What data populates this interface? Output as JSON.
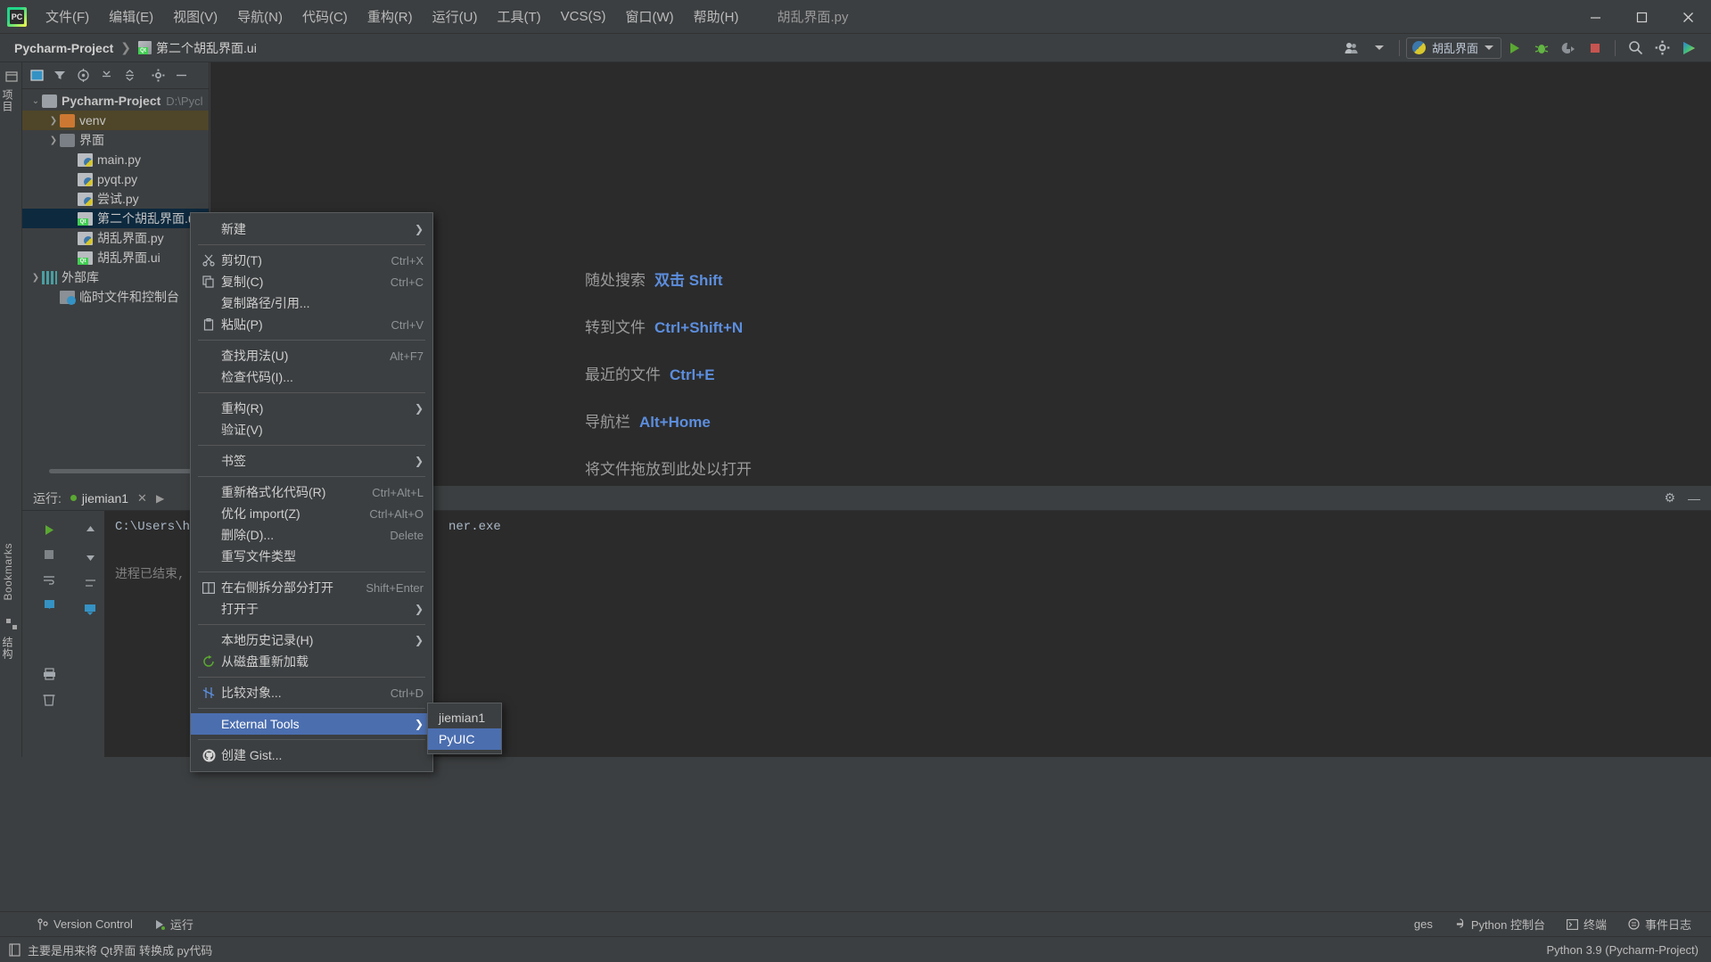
{
  "window": {
    "tab_title": "胡乱界面.py",
    "minimize": "—",
    "maximize": "▢",
    "close": "✕"
  },
  "menubar": [
    {
      "label": "文件(F)"
    },
    {
      "label": "编辑(E)"
    },
    {
      "label": "视图(V)"
    },
    {
      "label": "导航(N)"
    },
    {
      "label": "代码(C)"
    },
    {
      "label": "重构(R)"
    },
    {
      "label": "运行(U)"
    },
    {
      "label": "工具(T)"
    },
    {
      "label": "VCS(S)"
    },
    {
      "label": "窗口(W)"
    },
    {
      "label": "帮助(H)"
    }
  ],
  "navbar": {
    "crumb1": "Pycharm-Project",
    "separator": "❯",
    "crumb2": "第二个胡乱界面.ui",
    "run_config": "胡乱界面",
    "icons": {
      "profile": "profile-icon",
      "run": "▶",
      "debug": "debug-icon",
      "coverage": "coverage-icon",
      "stop": "■",
      "search": "⌕",
      "settings": "⚙",
      "updates": "updates-icon"
    }
  },
  "left_strip": {
    "project_label": "项目",
    "structure_label": "结构",
    "bookmarks_label": "Bookmarks"
  },
  "project_panel": {
    "toolbar_icons": [
      "window-icon",
      "filter-icon",
      "locate-icon",
      "expand-all-icon",
      "collapse-all-icon",
      "gear-icon",
      "hide-icon"
    ],
    "tree": [
      {
        "label": "Pycharm-Project",
        "path": "D:\\Pycl",
        "icon": "folder-icon",
        "arrow": "⌄",
        "indent": 0,
        "state": "root"
      },
      {
        "label": "venv",
        "path": "",
        "icon": "folder-orange-icon",
        "arrow": "❯",
        "indent": 1,
        "state": "hover"
      },
      {
        "label": "界面",
        "path": "",
        "icon": "folder-dark-icon",
        "arrow": "❯",
        "indent": 1,
        "state": "normal"
      },
      {
        "label": "main.py",
        "path": "",
        "icon": "python-file-icon",
        "arrow": "",
        "indent": 2,
        "state": "normal"
      },
      {
        "label": "pyqt.py",
        "path": "",
        "icon": "python-file-icon",
        "arrow": "",
        "indent": 2,
        "state": "normal"
      },
      {
        "label": "尝试.py",
        "path": "",
        "icon": "python-file-icon",
        "arrow": "",
        "indent": 2,
        "state": "normal"
      },
      {
        "label": "第二个胡乱界面.ui",
        "path": "",
        "icon": "qt-file-icon",
        "arrow": "",
        "indent": 2,
        "state": "selected"
      },
      {
        "label": "胡乱界面.py",
        "path": "",
        "icon": "python-file-icon",
        "arrow": "",
        "indent": 2,
        "state": "normal"
      },
      {
        "label": "胡乱界面.ui",
        "path": "",
        "icon": "qt-file-icon",
        "arrow": "",
        "indent": 2,
        "state": "normal"
      },
      {
        "label": "外部库",
        "path": "",
        "icon": "library-icon",
        "arrow": "❯",
        "indent": 0,
        "state": "normal"
      },
      {
        "label": "临时文件和控制台",
        "path": "",
        "icon": "scratch-icon",
        "arrow": "",
        "indent": 1,
        "state": "normal"
      }
    ]
  },
  "welcome": {
    "rows": [
      {
        "text": "随处搜索",
        "key": "双击 Shift"
      },
      {
        "text": "转到文件",
        "key": "Ctrl+Shift+N"
      },
      {
        "text": "最近的文件",
        "key": "Ctrl+E"
      },
      {
        "text": "导航栏",
        "key": "Alt+Home"
      },
      {
        "text": "将文件拖放到此处以打开",
        "key": ""
      }
    ]
  },
  "context_menu": {
    "items": [
      {
        "label": "新建",
        "shortcut": "",
        "icon": "",
        "arrow": "❯",
        "active": false,
        "sep_after": true
      },
      {
        "label": "剪切(T)",
        "shortcut": "Ctrl+X",
        "icon": "scissors-icon",
        "arrow": "",
        "active": false,
        "sep_after": false
      },
      {
        "label": "复制(C)",
        "shortcut": "Ctrl+C",
        "icon": "copy-icon",
        "arrow": "",
        "active": false,
        "sep_after": false
      },
      {
        "label": "复制路径/引用...",
        "shortcut": "",
        "icon": "",
        "arrow": "",
        "active": false,
        "sep_after": false
      },
      {
        "label": "粘贴(P)",
        "shortcut": "Ctrl+V",
        "icon": "clipboard-icon",
        "arrow": "",
        "active": false,
        "sep_after": true
      },
      {
        "label": "查找用法(U)",
        "shortcut": "Alt+F7",
        "icon": "",
        "arrow": "",
        "active": false,
        "sep_after": false
      },
      {
        "label": "检查代码(I)...",
        "shortcut": "",
        "icon": "",
        "arrow": "",
        "active": false,
        "sep_after": true
      },
      {
        "label": "重构(R)",
        "shortcut": "",
        "icon": "",
        "arrow": "❯",
        "active": false,
        "sep_after": false
      },
      {
        "label": "验证(V)",
        "shortcut": "",
        "icon": "",
        "arrow": "",
        "active": false,
        "sep_after": true
      },
      {
        "label": "书签",
        "shortcut": "",
        "icon": "",
        "arrow": "❯",
        "active": false,
        "sep_after": true
      },
      {
        "label": "重新格式化代码(R)",
        "shortcut": "Ctrl+Alt+L",
        "icon": "",
        "arrow": "",
        "active": false,
        "sep_after": false
      },
      {
        "label": "优化 import(Z)",
        "shortcut": "Ctrl+Alt+O",
        "icon": "",
        "arrow": "",
        "active": false,
        "sep_after": false
      },
      {
        "label": "删除(D)...",
        "shortcut": "Delete",
        "icon": "",
        "arrow": "",
        "active": false,
        "sep_after": false
      },
      {
        "label": "重写文件类型",
        "shortcut": "",
        "icon": "",
        "arrow": "",
        "active": false,
        "sep_after": true
      },
      {
        "label": "在右侧拆分部分打开",
        "shortcut": "Shift+Enter",
        "icon": "split-icon",
        "arrow": "",
        "active": false,
        "sep_after": false
      },
      {
        "label": "打开于",
        "shortcut": "",
        "icon": "",
        "arrow": "❯",
        "active": false,
        "sep_after": true
      },
      {
        "label": "本地历史记录(H)",
        "shortcut": "",
        "icon": "",
        "arrow": "❯",
        "active": false,
        "sep_after": false
      },
      {
        "label": "从磁盘重新加载",
        "shortcut": "",
        "icon": "reload-icon",
        "arrow": "",
        "active": false,
        "sep_after": true
      },
      {
        "label": "比较对象...",
        "shortcut": "Ctrl+D",
        "icon": "compare-icon",
        "arrow": "",
        "active": false,
        "sep_after": true
      },
      {
        "label": "External Tools",
        "shortcut": "",
        "icon": "",
        "arrow": "❯",
        "active": true,
        "sep_after": true
      },
      {
        "label": "创建 Gist...",
        "shortcut": "",
        "icon": "github-icon",
        "arrow": "",
        "active": false,
        "sep_after": false
      }
    ]
  },
  "submenu": {
    "items": [
      {
        "label": "jiemian1",
        "active": false
      },
      {
        "label": "PyUIC",
        "active": true
      }
    ]
  },
  "run_panel": {
    "title": "运行:",
    "tab_label": "jiemian1",
    "close": "✕",
    "console_lines": [
      "C:\\Users\\hun",
      "进程已结束, 退出"
    ],
    "console_fragment": "ner.exe",
    "gear": "⚙",
    "minimize": "—"
  },
  "toolwindow_bar": {
    "items": [
      {
        "label": "Version Control",
        "icon": "vcs-icon"
      },
      {
        "label": "运行",
        "icon": "run-icon"
      },
      {
        "label": "ges",
        "icon": ""
      },
      {
        "label": "Python 控制台",
        "icon": "python-console-icon"
      },
      {
        "label": "终端",
        "icon": "terminal-icon"
      }
    ],
    "event_log": "事件日志"
  },
  "statusbar": {
    "tooltip": "主要是用来将 Qt界面 转换成 py代码",
    "interpreter": "Python 3.9 (Pycharm-Project)"
  },
  "colors": {
    "accent_blue": "#4b6eaf",
    "selection": "#0d293e",
    "hover_brown": "#4f4629",
    "panel_bg": "#3c3f41",
    "editor_bg": "#2b2b2b",
    "link_blue": "#5c8ede",
    "tab_pink": "#c8476f"
  }
}
